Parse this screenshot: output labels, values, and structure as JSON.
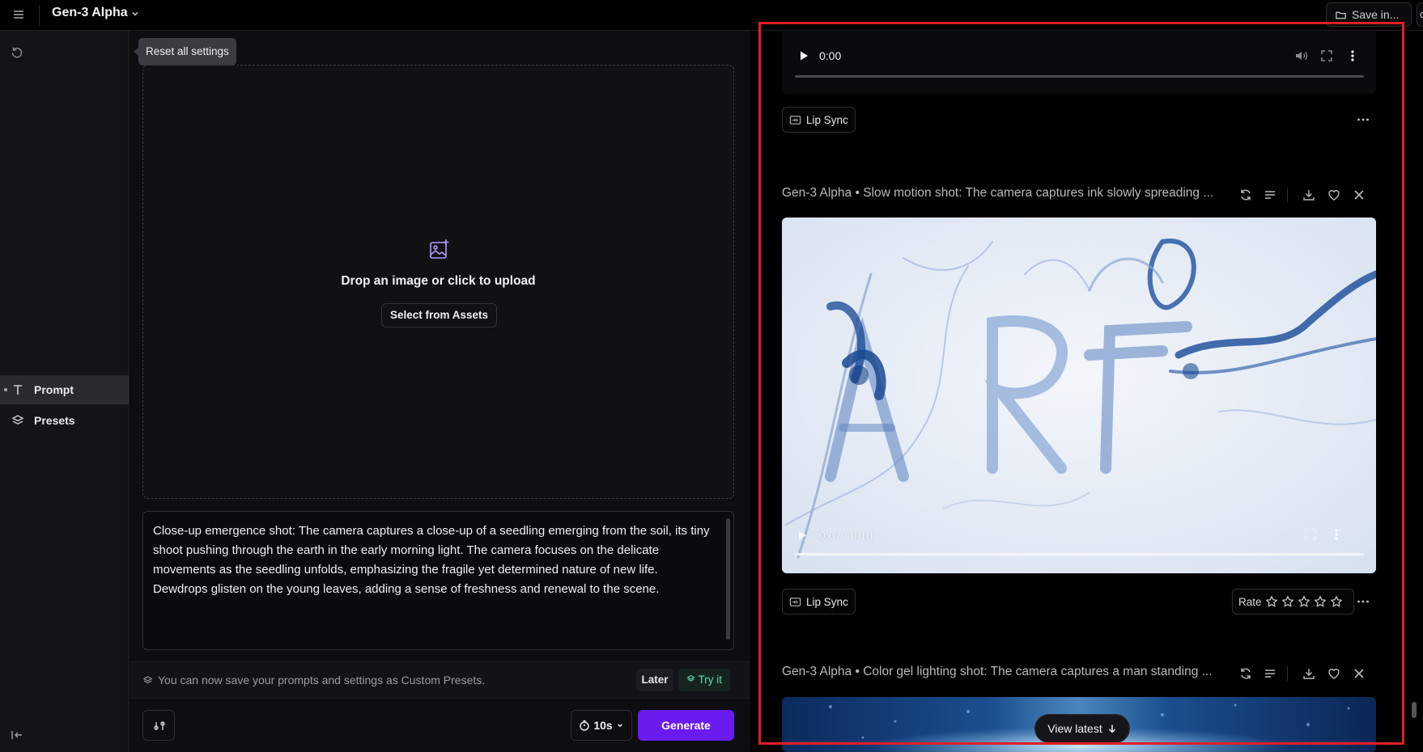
{
  "topbar": {
    "app_title": "Gen-3 Alpha",
    "save_label": "Save in...",
    "corner_label": "c"
  },
  "sidebar": {
    "reset_tooltip": "Reset all settings",
    "items": [
      {
        "label": "Prompt",
        "icon": "text-t-icon",
        "active": true
      },
      {
        "label": "Presets",
        "icon": "layers-icon",
        "active": false
      }
    ]
  },
  "upload": {
    "drop_text": "Drop an image or click to upload",
    "assets_button": "Select from Assets"
  },
  "prompt": {
    "text": "Close-up emergence shot: The camera captures a close-up of a seedling emerging from the soil, its tiny shoot pushing through the earth in the early morning light. The camera focuses on the delicate movements as the seedling unfolds, emphasizing the fragile yet determined nature of new life. Dewdrops glisten on the young leaves, adding a sense of freshness and renewal to the scene."
  },
  "tip": {
    "text": "You can now save your prompts and settings as Custom Presets.",
    "later_label": "Later",
    "tryit_label": "Try it"
  },
  "bottom": {
    "duration": "10s",
    "generate_label": "Generate"
  },
  "feed": {
    "top_player": {
      "time": "0:00"
    },
    "lip_sync_label": "Lip Sync",
    "generations": [
      {
        "title": "Gen-3 Alpha • Slow motion shot: The camera captures ink slowly spreading ...",
        "time": "0:07 / 0:10",
        "rate_label": "Rate",
        "stars": 5
      },
      {
        "title": "Gen-3 Alpha • Color gel lighting shot: The camera captures a man standing ..."
      }
    ],
    "view_latest_label": "View latest"
  },
  "colors": {
    "accent": "#6a1bf0",
    "highlight": "#e01f26",
    "tryit": "#5de0b2",
    "upload_icon": "#b39cff"
  }
}
